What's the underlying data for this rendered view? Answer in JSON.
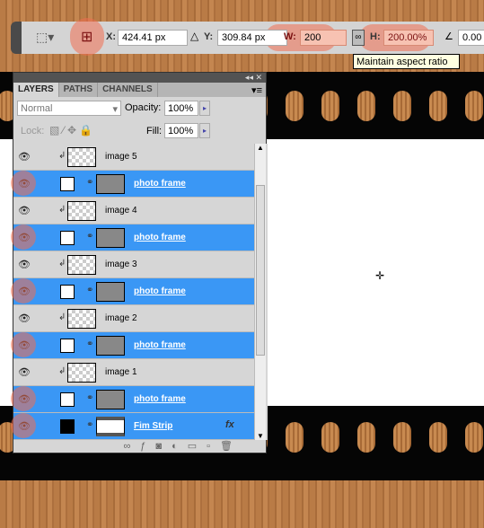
{
  "toolbar": {
    "x_label": "X:",
    "x_value": "424.41 px",
    "y_label": "Y:",
    "y_value": "309.84 px",
    "w_label": "W:",
    "w_value": "200",
    "h_label": "H:",
    "h_value": "200.00%",
    "angle_value": "0.00",
    "tooltip": "Maintain aspect ratio"
  },
  "panel": {
    "tabs": [
      {
        "label": "LAYERS"
      },
      {
        "label": "PATHS"
      },
      {
        "label": "CHANNELS"
      }
    ],
    "blend_mode": "Normal",
    "opacity_label": "Opacity:",
    "opacity": "100%",
    "lock_label": "Lock:",
    "fill_label": "Fill:",
    "fill": "100%",
    "layers": [
      {
        "name": "image 5",
        "type": "clipped"
      },
      {
        "name": "photo frame",
        "type": "selected"
      },
      {
        "name": "image 4",
        "type": "clipped"
      },
      {
        "name": "photo frame",
        "type": "selected"
      },
      {
        "name": "image 3",
        "type": "clipped"
      },
      {
        "name": "photo frame",
        "type": "selected"
      },
      {
        "name": "image 2",
        "type": "clipped"
      },
      {
        "name": "photo frame",
        "type": "selected"
      },
      {
        "name": "image 1",
        "type": "clipped"
      },
      {
        "name": "photo frame",
        "type": "selected"
      },
      {
        "name": "Fim Strip",
        "type": "selected",
        "fx": "fx"
      }
    ]
  },
  "colors": {
    "selection": "#3a97f5",
    "highlight": "#f06e50"
  }
}
